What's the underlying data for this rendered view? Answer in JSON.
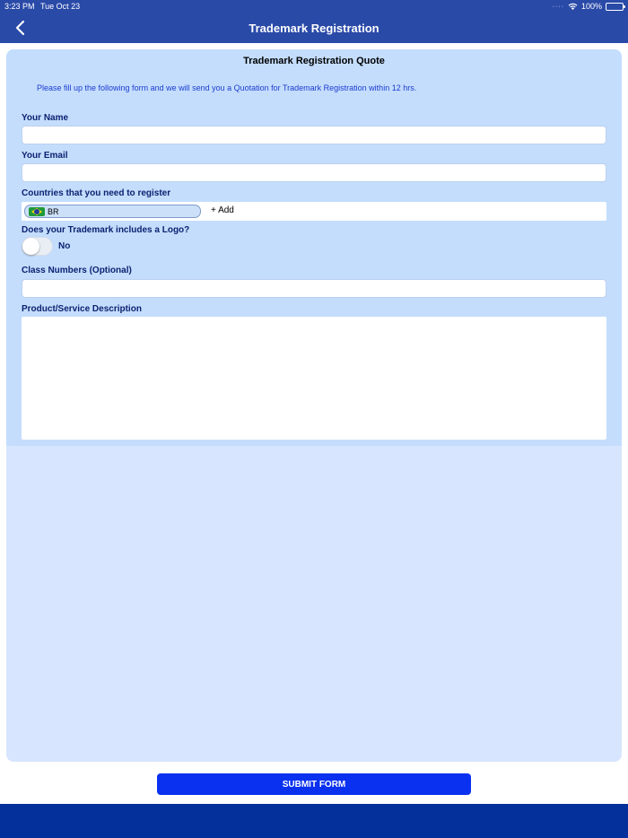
{
  "status_bar": {
    "time": "3:23 PM",
    "date": "Tue Oct 23",
    "battery": "100%",
    "icons": [
      "signal-dots-icon",
      "wifi-icon",
      "battery-icon"
    ]
  },
  "header": {
    "title": "Trademark Registration",
    "back_icon": "chevron-left-icon"
  },
  "form": {
    "title": "Trademark Registration Quote",
    "intro": "Please fill up the following form and we will send you a Quotation for Trademark Registration within 12 hrs.",
    "name": {
      "label": "Your Name",
      "value": ""
    },
    "email": {
      "label": "Your Email",
      "value": ""
    },
    "countries": {
      "label": "Countries that you need to register",
      "selected": [
        "BR"
      ],
      "add_label": "+ Add"
    },
    "logo": {
      "label": "Does your Trademark includes a Logo?",
      "value_label": "No",
      "enabled": false
    },
    "class_numbers": {
      "label": "Class Numbers (Optional)",
      "value": ""
    },
    "description": {
      "label": "Product/Service Description",
      "value": ""
    }
  },
  "submit_label": "SUBMIT FORM",
  "colors": {
    "header": "#2a4aa8",
    "card_top": "#c4ddfd",
    "card_bottom": "#d7e6fe",
    "label_text": "#0b2270",
    "intro_text": "#1b3ccf",
    "submit": "#0a31f0",
    "bottom_bar": "#03309a"
  }
}
